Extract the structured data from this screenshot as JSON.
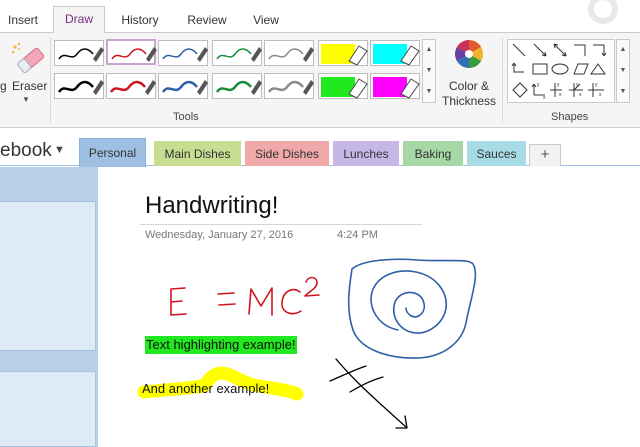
{
  "ribbon": {
    "tabs": [
      "Insert",
      "Draw",
      "History",
      "Review",
      "View"
    ],
    "active_tab": "Draw",
    "eraser_label": "Eraser",
    "partial_label": "g",
    "tools_group_label": "Tools",
    "shapes_group_label": "Shapes",
    "color_label_1": "Color &",
    "color_label_2": "Thickness",
    "pens": [
      {
        "color": "#000000",
        "type": "pen"
      },
      {
        "color": "#d0141d",
        "type": "pen"
      },
      {
        "color": "#2e5fa8",
        "type": "pen"
      },
      {
        "color": "#1a8c3a",
        "type": "pen"
      },
      {
        "color": "#8a8a8a",
        "type": "pen"
      },
      {
        "color": "#ffff00",
        "type": "highlighter"
      },
      {
        "color": "#00ffff",
        "type": "highlighter"
      },
      {
        "color": "#000000",
        "type": "pen"
      },
      {
        "color": "#d0141d",
        "type": "pen"
      },
      {
        "color": "#2e5fa8",
        "type": "pen"
      },
      {
        "color": "#1a8c3a",
        "type": "pen"
      },
      {
        "color": "#8a8a8a",
        "type": "pen"
      },
      {
        "color": "#22e81f",
        "type": "highlighter"
      },
      {
        "color": "#ff00ff",
        "type": "highlighter"
      }
    ],
    "selected_pen_index": 1
  },
  "notebook": {
    "name": "ebook",
    "sections": [
      {
        "label": "Personal",
        "color": "#9fc0e3"
      },
      {
        "label": "Main Dishes",
        "color": "#c6dd92"
      },
      {
        "label": "Side Dishes",
        "color": "#f0a8a8"
      },
      {
        "label": "Lunches",
        "color": "#c7b7e6"
      },
      {
        "label": "Baking",
        "color": "#a6d8a6"
      },
      {
        "label": "Sauces",
        "color": "#a7dbe6"
      }
    ],
    "add_tab_label": "+"
  },
  "page": {
    "title": "Handwriting!",
    "date": "Wednesday, January 27, 2016",
    "time": "4:24 PM",
    "highlight_text": "Text highlighting example!",
    "text2": "And another example!",
    "formula": "E = MC²"
  },
  "colors": {
    "accent": "#7a2b7c",
    "ink_red": "#d0141d",
    "ink_blue": "#2e5fa8",
    "highlight_green": "#22e81f",
    "highlight_yellow": "#ffff00"
  },
  "icons": [
    "eraser-icon",
    "color-wheel-icon",
    "dropdown-arrow-icon",
    "scroll-up-icon",
    "scroll-down-icon",
    "more-icon"
  ]
}
